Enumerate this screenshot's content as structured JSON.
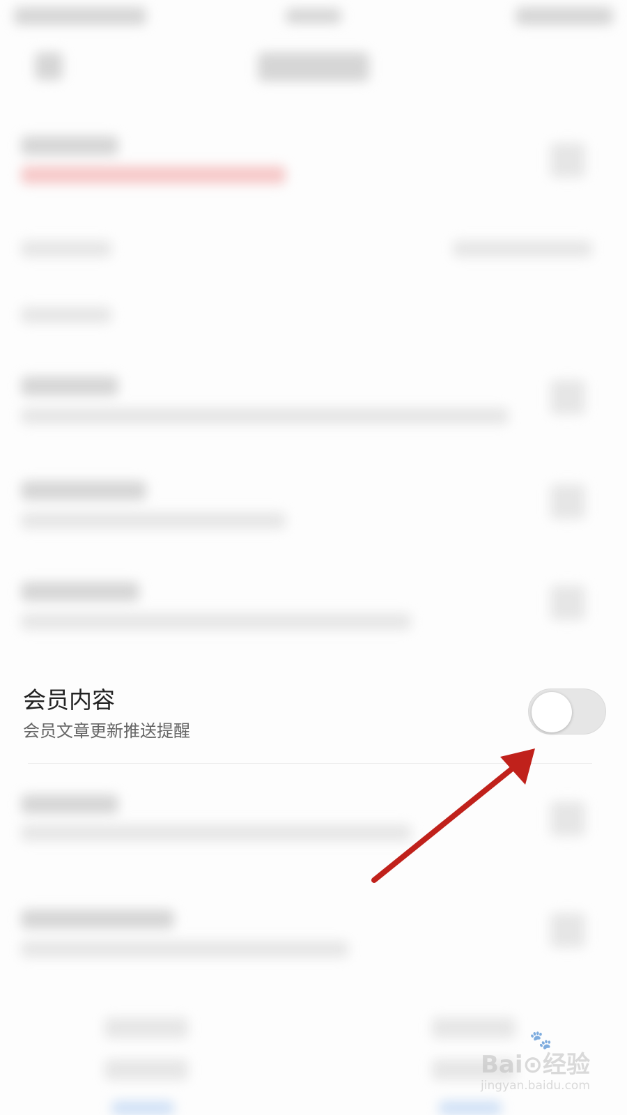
{
  "member_content": {
    "title": "会员内容",
    "subtitle": "会员文章更新推送提醒",
    "toggle_on": false
  },
  "watermark": {
    "logo": "Bai⊙经验",
    "url": "jingyan.baidu.com"
  },
  "colors": {
    "arrow": "#c0211b",
    "toggle_track_off": "#e6e6e6"
  }
}
